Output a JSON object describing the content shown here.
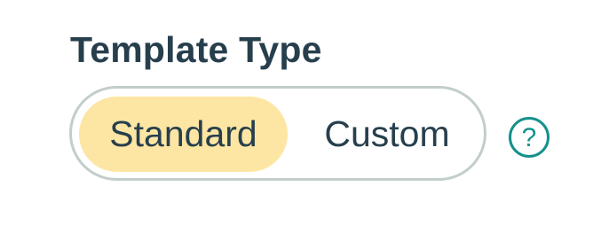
{
  "section": {
    "title": "Template Type"
  },
  "segmented_control": {
    "options": [
      {
        "label": "Standard",
        "selected": true
      },
      {
        "label": "Custom",
        "selected": false
      }
    ],
    "selected_value": "Standard"
  },
  "help": {
    "icon": "question-mark-circle-icon",
    "glyph": "?",
    "color": "#14918c"
  },
  "colors": {
    "text": "#273f4d",
    "selected_bg": "#fde6a4",
    "control_border": "#c2cdcc",
    "accent": "#14918c"
  }
}
